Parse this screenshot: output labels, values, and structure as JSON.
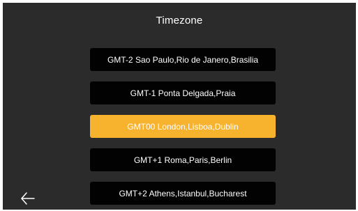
{
  "header": {
    "title": "Timezone"
  },
  "timezones": [
    {
      "label": "GMT-2 Sao Paulo,Rio de Janero,Brasilia",
      "selected": false
    },
    {
      "label": "GMT-1 Ponta Delgada,Praia",
      "selected": false
    },
    {
      "label": "GMT00 London,Lisboa,Dublin",
      "selected": true
    },
    {
      "label": "GMT+1 Roma,Paris,Berlin",
      "selected": false
    },
    {
      "label": "GMT+2 Athens,Istanbul,Bucharest",
      "selected": false
    }
  ],
  "back_icon": "arrow-left-icon",
  "colors": {
    "background": "#2b2b2b",
    "item_background": "#020202",
    "selected_accent": "#f7b22e",
    "text": "#ffffff"
  }
}
